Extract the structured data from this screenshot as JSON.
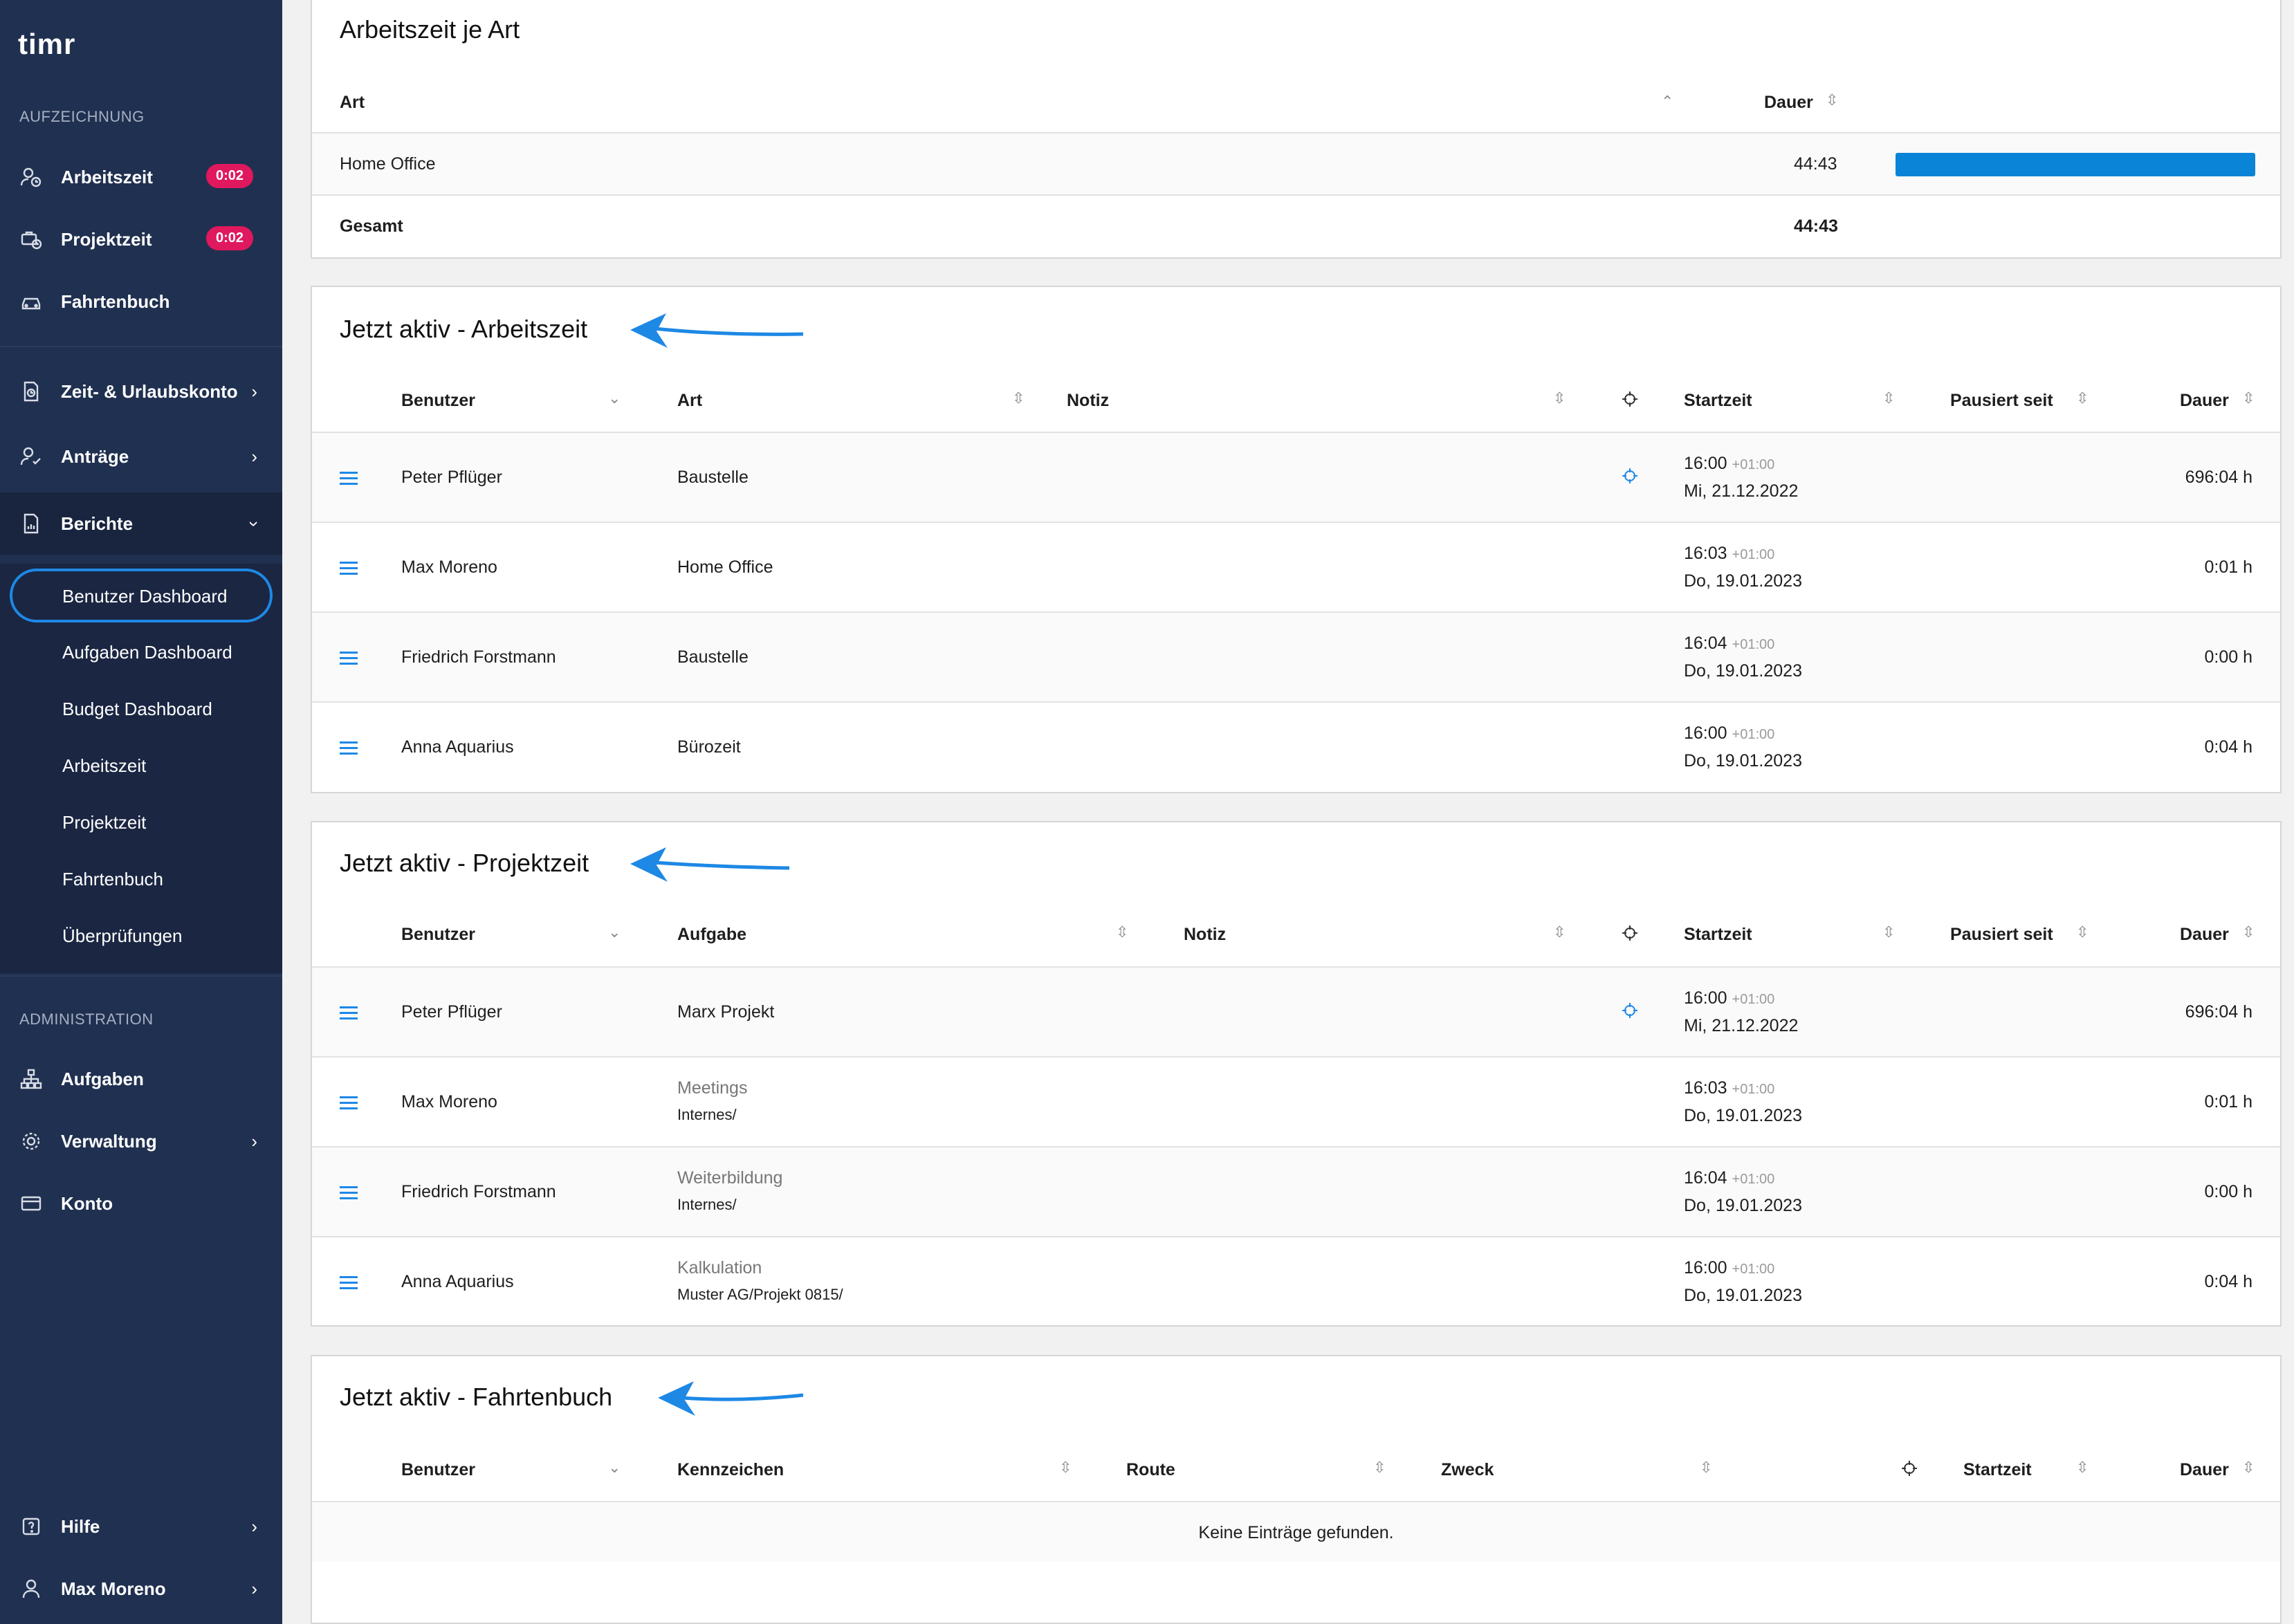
{
  "sidebar": {
    "logo": "timr",
    "section_recording": "AUFZEICHNUNG",
    "arbeitszeit": {
      "label": "Arbeitszeit",
      "badge": "0:02"
    },
    "projektzeit": {
      "label": "Projektzeit",
      "badge": "0:02"
    },
    "fahrtenbuch": {
      "label": "Fahrtenbuch"
    },
    "zeit_urlaub": {
      "label": "Zeit- & Urlaubskonto"
    },
    "antraege": {
      "label": "Anträge"
    },
    "berichte": {
      "label": "Berichte"
    },
    "reports": [
      "Benutzer Dashboard",
      "Aufgaben Dashboard",
      "Budget Dashboard",
      "Arbeitszeit",
      "Projektzeit",
      "Fahrtenbuch",
      "Überprüfungen"
    ],
    "section_admin": "ADMINISTRATION",
    "aufgaben": {
      "label": "Aufgaben"
    },
    "verwaltung": {
      "label": "Verwaltung"
    },
    "konto": {
      "label": "Konto"
    },
    "hilfe": {
      "label": "Hilfe"
    },
    "user": {
      "label": "Max Moreno"
    }
  },
  "type_panel": {
    "title": "Arbeitszeit je Art",
    "col_art": "Art",
    "col_dauer": "Dauer",
    "rows": [
      {
        "art": "Home Office",
        "dauer": "44:43",
        "share": 1.0
      }
    ],
    "total_label": "Gesamt",
    "total_value": "44:43"
  },
  "work_panel": {
    "title": "Jetzt aktiv - Arbeitszeit",
    "cols": {
      "benutzer": "Benutzer",
      "art": "Art",
      "notiz": "Notiz",
      "startzeit": "Startzeit",
      "pausiert": "Pausiert seit",
      "dauer": "Dauer"
    },
    "rows": [
      {
        "user": "Peter Pflüger",
        "type": "Baustelle",
        "time": "16:00",
        "tz": "+01:00",
        "date": "Mi, 21.12.2022",
        "dauer": "696:04 h"
      },
      {
        "user": "Max Moreno",
        "type": "Home Office",
        "time": "16:03",
        "tz": "+01:00",
        "date": "Do, 19.01.2023",
        "dauer": "0:01 h"
      },
      {
        "user": "Friedrich Forstmann",
        "type": "Baustelle",
        "time": "16:04",
        "tz": "+01:00",
        "date": "Do, 19.01.2023",
        "dauer": "0:00 h"
      },
      {
        "user": "Anna Aquarius",
        "type": "Bürozeit",
        "time": "16:00",
        "tz": "+01:00",
        "date": "Do, 19.01.2023",
        "dauer": "0:04 h"
      }
    ]
  },
  "project_panel": {
    "title": "Jetzt aktiv - Projektzeit",
    "cols": {
      "benutzer": "Benutzer",
      "aufgabe": "Aufgabe",
      "notiz": "Notiz",
      "startzeit": "Startzeit",
      "pausiert": "Pausiert seit",
      "dauer": "Dauer"
    },
    "rows": [
      {
        "user": "Peter Pflüger",
        "task": "Marx Projekt",
        "path": "",
        "time": "16:00",
        "tz": "+01:00",
        "date": "Mi, 21.12.2022",
        "dauer": "696:04 h"
      },
      {
        "user": "Max Moreno",
        "task": "Meetings",
        "path": "Internes/",
        "time": "16:03",
        "tz": "+01:00",
        "date": "Do, 19.01.2023",
        "dauer": "0:01 h"
      },
      {
        "user": "Friedrich Forstmann",
        "task": "Weiterbildung",
        "path": "Internes/",
        "time": "16:04",
        "tz": "+01:00",
        "date": "Do, 19.01.2023",
        "dauer": "0:00 h"
      },
      {
        "user": "Anna Aquarius",
        "task": "Kalkulation",
        "path": "Muster AG/Projekt 0815/",
        "time": "16:00",
        "tz": "+01:00",
        "date": "Do, 19.01.2023",
        "dauer": "0:04 h"
      }
    ]
  },
  "trip_panel": {
    "title": "Jetzt aktiv - Fahrtenbuch",
    "cols": {
      "benutzer": "Benutzer",
      "kennzeichen": "Kennzeichen",
      "route": "Route",
      "zweck": "Zweck",
      "startzeit": "Startzeit",
      "dauer": "Dauer"
    },
    "empty": "Keine Einträge gefunden."
  },
  "colors": {
    "sidebar": "#203050",
    "accent": "#1e88e5",
    "badge": "#e0185e",
    "bar": "#0a84d6"
  }
}
